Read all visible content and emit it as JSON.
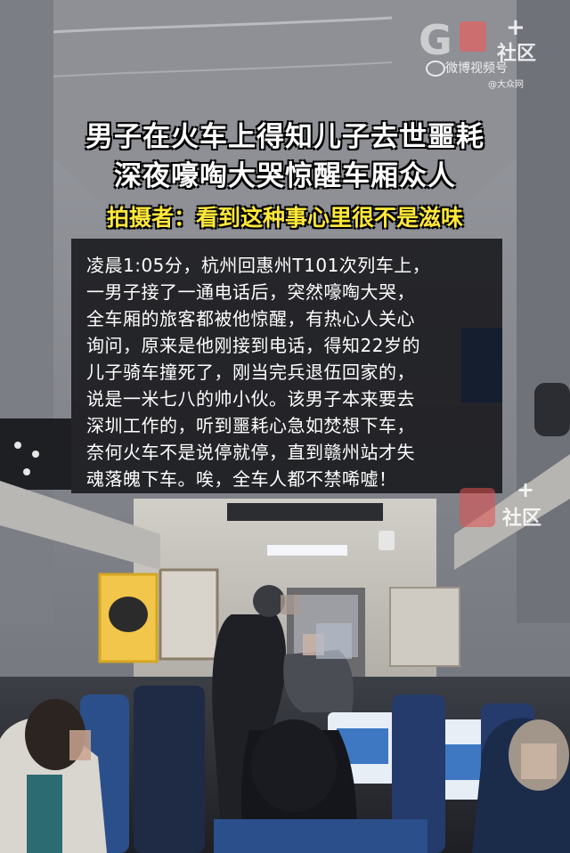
{
  "watermark_top": {
    "logo": "G",
    "plus": "+",
    "community": "社区",
    "platform": "微博视频号",
    "source": "@大众网"
  },
  "headline": {
    "line1": "男子在火车上得知儿子去世噩耗",
    "line2": "深夜嚎啕大哭惊醒车厢众人"
  },
  "subheadline": "拍摄者：看到这种事心里很不是滋味",
  "story_lines": [
    "凌晨1:05分，杭州回惠州T101次列车上，",
    "一男子接了一通电话后，突然嚎啕大哭，",
    "全车厢的旅客都被他惊醒，有热心人关心",
    "询问，原来是他刚接到电话，得知22岁的",
    "儿子骑车撞死了，刚当完兵退伍回家的，",
    "说是一米七八的帅小伙。该男子本来要去",
    "深圳工作的，听到噩耗心急如焚想下车，",
    "奈何火车不是说停就停，直到赣州站才失",
    "魂落魄下车。唉，全车人都不禁唏嘘！"
  ],
  "watermark_mid": {
    "plus": "+",
    "community": "社区"
  },
  "scene_colors": {
    "seat_blue": "#2b4f8a",
    "seat_cover": "#e8eef5",
    "ceiling": "#8b8d92",
    "wall": "#c9c6c0"
  }
}
